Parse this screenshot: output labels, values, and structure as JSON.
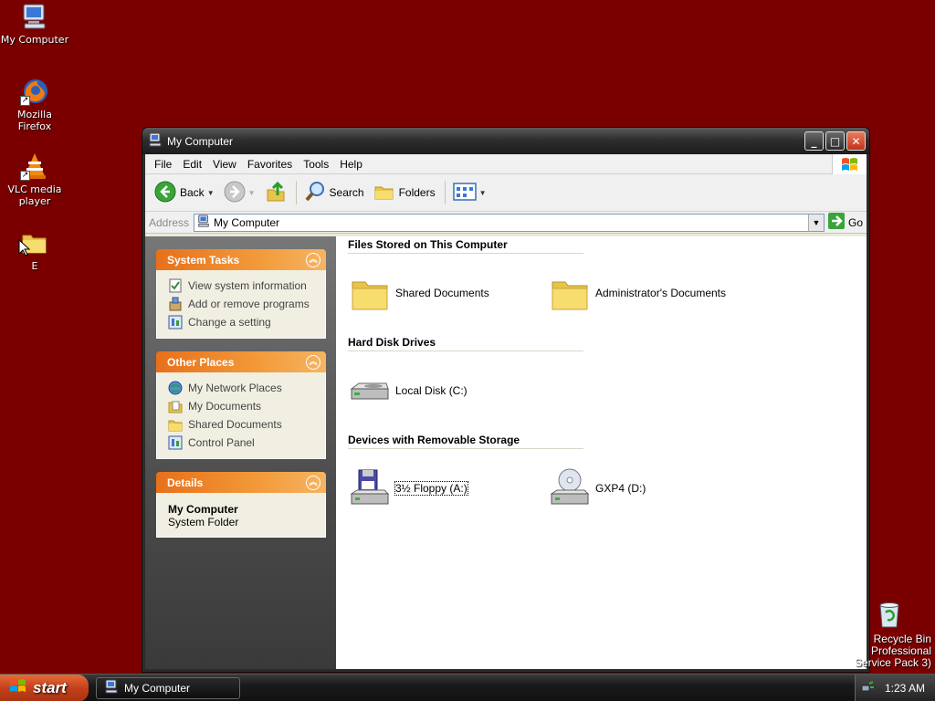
{
  "desktop": {
    "icons": [
      {
        "label": "My Computer",
        "icon": "my-computer-icon"
      },
      {
        "label": "Mozilla Firefox",
        "icon": "firefox-icon"
      },
      {
        "label": "VLC media player",
        "icon": "vlc-icon"
      },
      {
        "label": "E",
        "icon": "folder-icon"
      }
    ],
    "recycle_bin": {
      "label": "Recycle Bin",
      "icon": "recycle-bin-icon"
    },
    "watermark": [
      "Professional",
      "Service Pack 3)"
    ]
  },
  "window": {
    "title": "My Computer",
    "controls": {
      "minimize": "minimize-icon",
      "maximize": "maximize-icon",
      "close": "close-icon"
    },
    "menu": [
      "File",
      "Edit",
      "View",
      "Favorites",
      "Tools",
      "Help"
    ],
    "toolbar": {
      "back": "Back",
      "search": "Search",
      "folders": "Folders"
    },
    "address": {
      "label": "Address",
      "value": "My Computer",
      "go": "Go"
    }
  },
  "taskpane": {
    "system_tasks": {
      "title": "System Tasks",
      "links": [
        {
          "label": "View system information",
          "icon": "system-info-icon"
        },
        {
          "label": "Add or remove programs",
          "icon": "add-remove-programs-icon"
        },
        {
          "label": "Change a setting",
          "icon": "control-panel-icon"
        }
      ]
    },
    "other_places": {
      "title": "Other Places",
      "links": [
        {
          "label": "My Network Places",
          "icon": "network-places-icon"
        },
        {
          "label": "My Documents",
          "icon": "my-documents-icon"
        },
        {
          "label": "Shared Documents",
          "icon": "folder-icon"
        },
        {
          "label": "Control Panel",
          "icon": "control-panel-icon"
        }
      ]
    },
    "details": {
      "title": "Details",
      "name": "My Computer",
      "type": "System Folder"
    }
  },
  "main": {
    "groups": [
      {
        "title": "Files Stored on This Computer",
        "items": [
          {
            "label": "Shared Documents",
            "icon": "folder-icon"
          },
          {
            "label": "Administrator's Documents",
            "icon": "folder-icon"
          }
        ]
      },
      {
        "title": "Hard Disk Drives",
        "items": [
          {
            "label": "Local Disk (C:)",
            "icon": "hard-disk-icon"
          }
        ]
      },
      {
        "title": "Devices with Removable Storage",
        "items": [
          {
            "label": "3½ Floppy (A:)",
            "icon": "floppy-drive-icon"
          },
          {
            "label": "GXP4 (D:)",
            "icon": "cd-drive-icon"
          }
        ]
      }
    ]
  },
  "taskbar": {
    "start": "start",
    "task": "My Computer",
    "clock": "1:23 AM"
  },
  "colors": {
    "desktop": "#7a0000",
    "taskpane_header": "#e8701a",
    "start_button": "#c4401a"
  }
}
